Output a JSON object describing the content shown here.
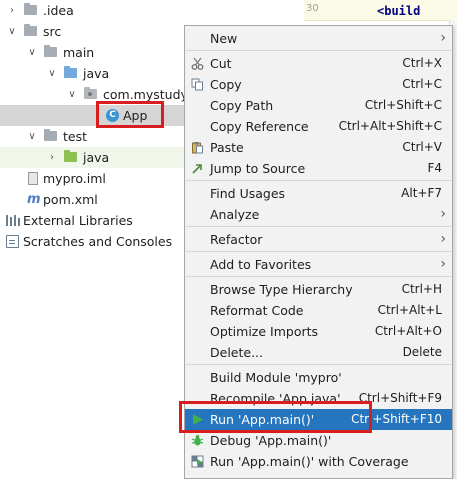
{
  "tree": {
    "items": [
      {
        "label": ".idea"
      },
      {
        "label": "src"
      },
      {
        "label": "main"
      },
      {
        "label": "java"
      },
      {
        "label": "com.mystudy"
      },
      {
        "label": "App"
      },
      {
        "label": "test"
      },
      {
        "label": "java"
      },
      {
        "label": "mypro.iml"
      },
      {
        "label": "pom.xml"
      },
      {
        "label": "External Libraries"
      },
      {
        "label": "Scratches and Consoles"
      }
    ]
  },
  "editor": {
    "line_number": "30",
    "code": "<build"
  },
  "menu": {
    "items": [
      {
        "label": "New",
        "shortcut": ""
      },
      {
        "label": "Cut",
        "shortcut": "Ctrl+X"
      },
      {
        "label": "Copy",
        "shortcut": "Ctrl+C"
      },
      {
        "label": "Copy Path",
        "shortcut": "Ctrl+Shift+C"
      },
      {
        "label": "Copy Reference",
        "shortcut": "Ctrl+Alt+Shift+C"
      },
      {
        "label": "Paste",
        "shortcut": "Ctrl+V"
      },
      {
        "label": "Jump to Source",
        "shortcut": "F4"
      },
      {
        "label": "Find Usages",
        "shortcut": "Alt+F7"
      },
      {
        "label": "Analyze",
        "shortcut": ""
      },
      {
        "label": "Refactor",
        "shortcut": ""
      },
      {
        "label": "Add to Favorites",
        "shortcut": ""
      },
      {
        "label": "Browse Type Hierarchy",
        "shortcut": "Ctrl+H"
      },
      {
        "label": "Reformat Code",
        "shortcut": "Ctrl+Alt+L"
      },
      {
        "label": "Optimize Imports",
        "shortcut": "Ctrl+Alt+O"
      },
      {
        "label": "Delete...",
        "shortcut": "Delete"
      },
      {
        "label": "Build Module 'mypro'",
        "shortcut": ""
      },
      {
        "label": "Recompile 'App.java'",
        "shortcut": "Ctrl+Shift+F9"
      },
      {
        "label": "Run 'App.main()'",
        "shortcut": "Ctrl+Shift+F10"
      },
      {
        "label": "Debug 'App.main()'",
        "shortcut": ""
      },
      {
        "label": "Run 'App.main()' with Coverage",
        "shortcut": ""
      }
    ]
  },
  "colors": {
    "highlight": "#2675bf",
    "annotation": "#d81e1e",
    "source_folder": "#73a9db",
    "test_folder": "#8cc152"
  }
}
